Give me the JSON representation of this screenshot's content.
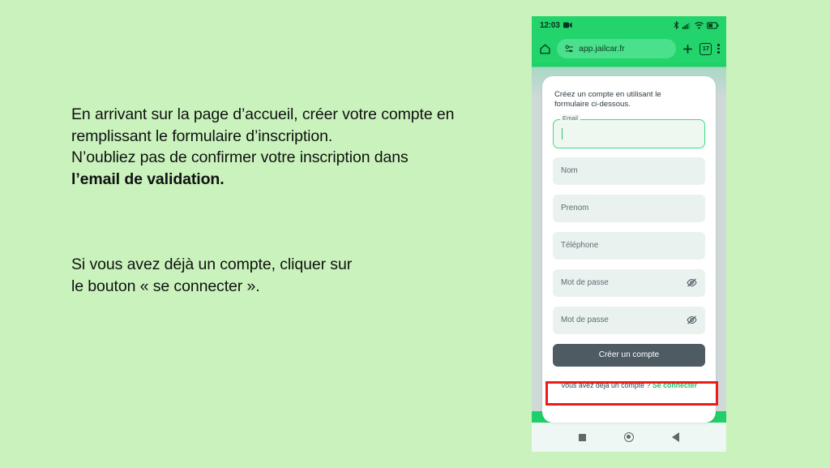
{
  "slide": {
    "background_color": "#c9f2bc"
  },
  "instructions": {
    "block1": {
      "line1": "En arrivant sur la page d’accueil, créer votre compte en",
      "line2": "remplissant le formulaire d’inscription.",
      "line3": "N’oubliez pas de confirmer votre inscription dans",
      "line4_bold": "l’email de validation."
    },
    "block2": {
      "line1": "Si vous avez déjà un compte, cliquer sur",
      "line2": "le bouton « se connecter »."
    }
  },
  "phone": {
    "statusbar": {
      "time": "12:03",
      "icons": [
        "video-camera-icon",
        "bluetooth-icon",
        "cellular-signal-icon",
        "wifi-icon",
        "battery-icon"
      ],
      "background_color": "#22d46b"
    },
    "browser": {
      "home_icon": "home-icon",
      "page_info_icon": "page-info-icon",
      "url": "app.jailcar.fr",
      "new_tab_icon": "plus-icon",
      "tab_count": "17",
      "menu_icon": "kebab-menu-icon"
    },
    "page": {
      "intro_line1": "Créez un compte en utilisant le",
      "intro_line2": "formulaire ci-dessous.",
      "fields": [
        {
          "name": "email",
          "label": "Email",
          "value": "",
          "focused": true,
          "has_eye": false
        },
        {
          "name": "nom",
          "placeholder": "Nom",
          "value": "",
          "focused": false,
          "has_eye": false
        },
        {
          "name": "prenom",
          "placeholder": "Prenom",
          "value": "",
          "focused": false,
          "has_eye": false
        },
        {
          "name": "telephone",
          "placeholder": "Téléphone",
          "value": "",
          "focused": false,
          "has_eye": false
        },
        {
          "name": "password",
          "placeholder": "Mot de passe",
          "value": "",
          "focused": false,
          "has_eye": true
        },
        {
          "name": "password-confirm",
          "placeholder": "Mot de passe",
          "value": "",
          "focused": false,
          "has_eye": true
        }
      ],
      "submit_label": "Créer un compte",
      "login_prompt": "Vous avez déjà un compte ?",
      "login_link": "Se connecter",
      "accent_color": "#2bbd6a",
      "submit_color": "#4e5b63"
    },
    "navbar": {
      "recents_icon": "square-recents-icon",
      "home_icon": "circle-home-icon",
      "back_icon": "triangle-back-icon"
    }
  },
  "annotation": {
    "highlight_color": "#ee1b1b",
    "target": "login-link-row"
  }
}
